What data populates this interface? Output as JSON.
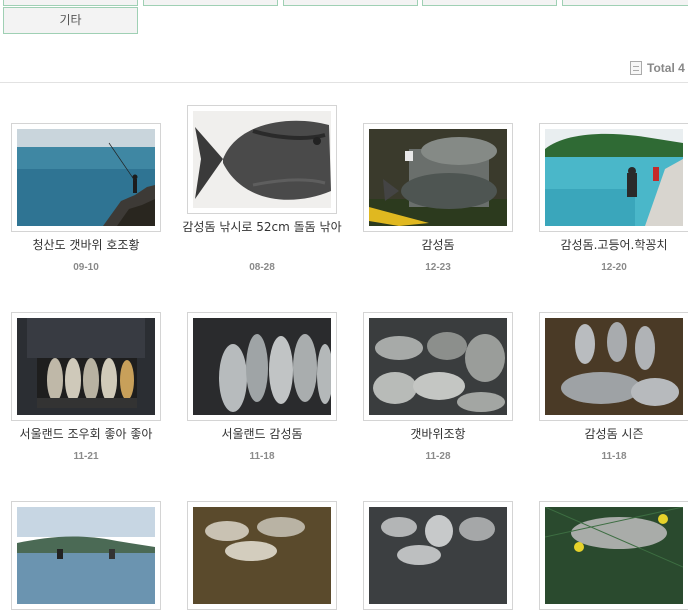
{
  "category": {
    "other_label": "기타"
  },
  "summary": {
    "total_label": "Total 4"
  },
  "gallery": [
    {
      "title": "청산도 갯바위 호조황",
      "date": "09-10"
    },
    {
      "title": "감성돔 낚시로 52cm 돌돔 낚아",
      "date": "08-28"
    },
    {
      "title": "감성돔",
      "date": "12-23"
    },
    {
      "title": "감성돔.고등어.학꽁치",
      "date": "12-20"
    },
    {
      "title": "서울랜드 조우회 좋아 좋아",
      "date": "11-21"
    },
    {
      "title": "서울랜드 감성돔",
      "date": "11-18"
    },
    {
      "title": "갯바위조항",
      "date": "11-28"
    },
    {
      "title": "감성돔 시즌",
      "date": "11-18"
    },
    {
      "title": "",
      "date": ""
    },
    {
      "title": "",
      "date": ""
    },
    {
      "title": "",
      "date": ""
    },
    {
      "title": "",
      "date": ""
    }
  ]
}
